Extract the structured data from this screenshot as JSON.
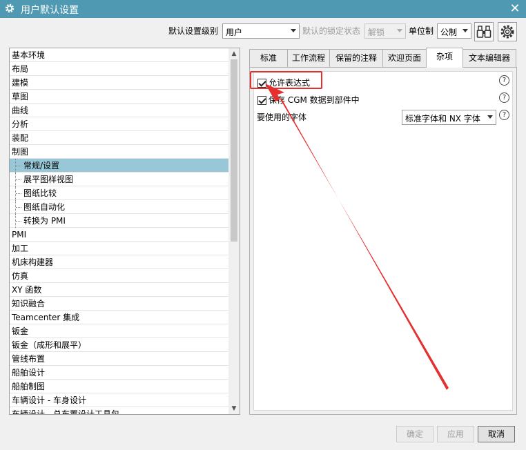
{
  "window": {
    "title": "用户默认设置",
    "close": "✕"
  },
  "toolbar": {
    "level_label": "默认设置级别",
    "level_value": "用户",
    "lock_label": "默认的锁定状态",
    "lock_value": "解锁",
    "unit_label": "单位制",
    "unit_value": "公制"
  },
  "tree": {
    "items": [
      {
        "label": "基本环境"
      },
      {
        "label": "布局"
      },
      {
        "label": "建模"
      },
      {
        "label": "草图"
      },
      {
        "label": "曲线"
      },
      {
        "label": "分析"
      },
      {
        "label": "装配"
      },
      {
        "label": "制图"
      },
      {
        "label": "常规/设置",
        "child": true,
        "selected": true
      },
      {
        "label": "展平图样视图",
        "child": true
      },
      {
        "label": "图纸比较",
        "child": true
      },
      {
        "label": "图纸自动化",
        "child": true
      },
      {
        "label": "转换为 PMI",
        "child": true
      },
      {
        "label": "PMI"
      },
      {
        "label": "加工"
      },
      {
        "label": "机床构建器"
      },
      {
        "label": "仿真"
      },
      {
        "label": "XY 函数"
      },
      {
        "label": "知识融合"
      },
      {
        "label": "Teamcenter 集成"
      },
      {
        "label": "钣金"
      },
      {
        "label": "钣金（成形和展平）"
      },
      {
        "label": "管线布置"
      },
      {
        "label": "船舶设计"
      },
      {
        "label": "船舶制图"
      },
      {
        "label": "车辆设计 - 车身设计"
      },
      {
        "label": "车辆设计 - 总布置设计工具包"
      }
    ]
  },
  "tabs": [
    {
      "label": "标准"
    },
    {
      "label": "工作流程"
    },
    {
      "label": "保留的注释"
    },
    {
      "label": "欢迎页面"
    },
    {
      "label": "杂项",
      "active": true
    },
    {
      "label": "文本编辑器"
    }
  ],
  "panel": {
    "allow_expressions": {
      "label": "允许表达式",
      "checked": true
    },
    "save_cgm": {
      "label": "保存 CGM 数据到部件中",
      "checked": true
    },
    "font_label": "要使用的字体",
    "font_value": "标准字体和 NX 字体",
    "help_glyph": "?"
  },
  "buttons": {
    "ok": "确定",
    "apply": "应用",
    "cancel": "取消"
  },
  "annotation": {
    "color": "#e53030"
  }
}
